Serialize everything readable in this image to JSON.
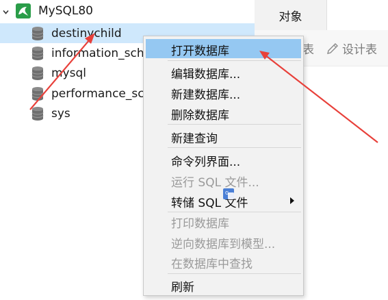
{
  "tree": {
    "connection": {
      "label": "MySQL80",
      "icon": "mysql-connection-icon",
      "expanded": true
    },
    "databases": [
      {
        "label": "destinychild",
        "selected": true
      },
      {
        "label": "information_sch"
      },
      {
        "label": "mysql"
      },
      {
        "label": "performance_sc"
      },
      {
        "label": "sys"
      }
    ]
  },
  "tabs": {
    "objects": "对象"
  },
  "toolbar": {
    "item1": "表",
    "design_table": "设计表"
  },
  "context_menu": {
    "items": [
      {
        "label": "打开数据库",
        "highlighted": true,
        "enabled": true
      },
      {
        "label": "编辑数据库...",
        "enabled": true
      },
      {
        "label": "新建数据库...",
        "enabled": true
      },
      {
        "label": "删除数据库",
        "enabled": true
      },
      {
        "label": "新建查询",
        "enabled": true
      },
      {
        "label": "命令列界面...",
        "enabled": true
      },
      {
        "label": "运行 SQL 文件...",
        "enabled": false
      },
      {
        "label": "转储 SQL 文件",
        "enabled": true,
        "submenu": true
      },
      {
        "label": "打印数据库",
        "enabled": false
      },
      {
        "label": "逆向数据库到模型...",
        "enabled": false
      },
      {
        "label": "在数据库中查找",
        "enabled": false
      },
      {
        "label": "刷新",
        "enabled": true
      }
    ]
  },
  "colors": {
    "selection": "#cfe8fc",
    "menu_highlight": "#95c8f2",
    "annotation": "#e8403a",
    "mysql_green": "#2a9d49"
  }
}
